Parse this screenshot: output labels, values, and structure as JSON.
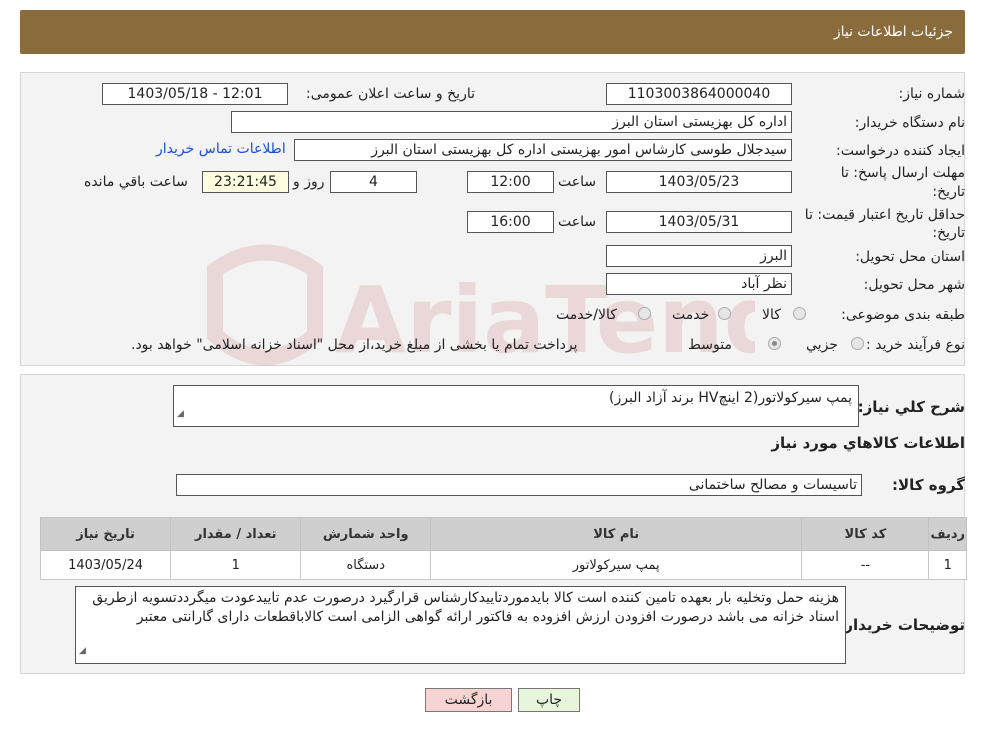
{
  "header": {
    "title": "جزئیات اطلاعات نیاز"
  },
  "watermark": {
    "text": "AriaTender.neT",
    "color": "#b22222"
  },
  "form": {
    "need_number_label": "شماره نیاز:",
    "need_number": "1103003864000040",
    "announce_label": "تاریخ و ساعت اعلان عمومی:",
    "announce_value": "1403/05/18 - 12:01",
    "buyer_label": "نام دستگاه خریدار:",
    "buyer_value": "اداره کل بهزیستی استان البرز",
    "requester_label": "ایجاد کننده درخواست:",
    "requester_value": "سیدجلال طوسی کارشاس امور بهزیستی اداره کل بهزیستی استان البرز",
    "contact_link": "اطلاعات تماس خریدار",
    "deadline_label_1": "مهلت ارسال پاسخ: تا",
    "deadline_label_2": "تاریخ:",
    "deadline_date": "1403/05/23",
    "time_label": "ساعت",
    "deadline_time": "12:00",
    "days_value": "4",
    "days_label": "روز و",
    "remaining_time": "23:21:45",
    "remaining_label": "ساعت باقي مانده",
    "validity_label_1": "حداقل تاریخ اعتبار قیمت: تا",
    "validity_label_2": "تاریخ:",
    "validity_date": "1403/05/31",
    "validity_time": "16:00",
    "province_label": "استان محل تحویل:",
    "province_value": "البرز",
    "city_label": "شهر محل تحویل:",
    "city_value": "نظر آباد",
    "category_label": "طبقه بندی موضوعی:",
    "category_options": [
      "کالا",
      "خدمت",
      "کالا/خدمت"
    ],
    "process_label": "نوع فرآیند خرید :",
    "process_options": [
      "جزیي",
      "متوسط"
    ],
    "process_note": "پرداخت تمام یا بخشی از مبلغ خرید،از محل \"اسناد خزانه اسلامی\" خواهد بود."
  },
  "summary": {
    "label": "شرح کلي نیاز:",
    "value": "پمپ سیرکولاتور(2  اینچHV برند آزاد البرز)",
    "goods_title": "اطلاعات کالاهاي مورد نیاز",
    "group_label": "گروه کالا:",
    "group_value": "تاسیسات و مصالح ساختمانی"
  },
  "table": {
    "headers": [
      "ردیف",
      "کد کالا",
      "نام کالا",
      "واحد شمارش",
      "تعداد / مقدار",
      "تاریخ نیاز"
    ],
    "rows": [
      [
        "1",
        "--",
        "پمپ سیرکولاتور",
        "دستگاه",
        "1",
        "1403/05/24"
      ]
    ]
  },
  "notes": {
    "label": "توضیحات خریدار:",
    "value": "هزینه حمل وتخلیه بار بعهده تامین کننده است کالا بایدموردتاییدکارشناس قرارگیرد درصورت عدم تاییدعودت میگرددتسویه ازطریق اسناد خزانه می باشد درصورت افزودن ارزش افزوده به فاکتور ارائه گواهی الزامی است کالاباقطعات دارای گارانتی معتبر"
  },
  "buttons": {
    "print": "چاپ",
    "back": "بازگشت"
  }
}
